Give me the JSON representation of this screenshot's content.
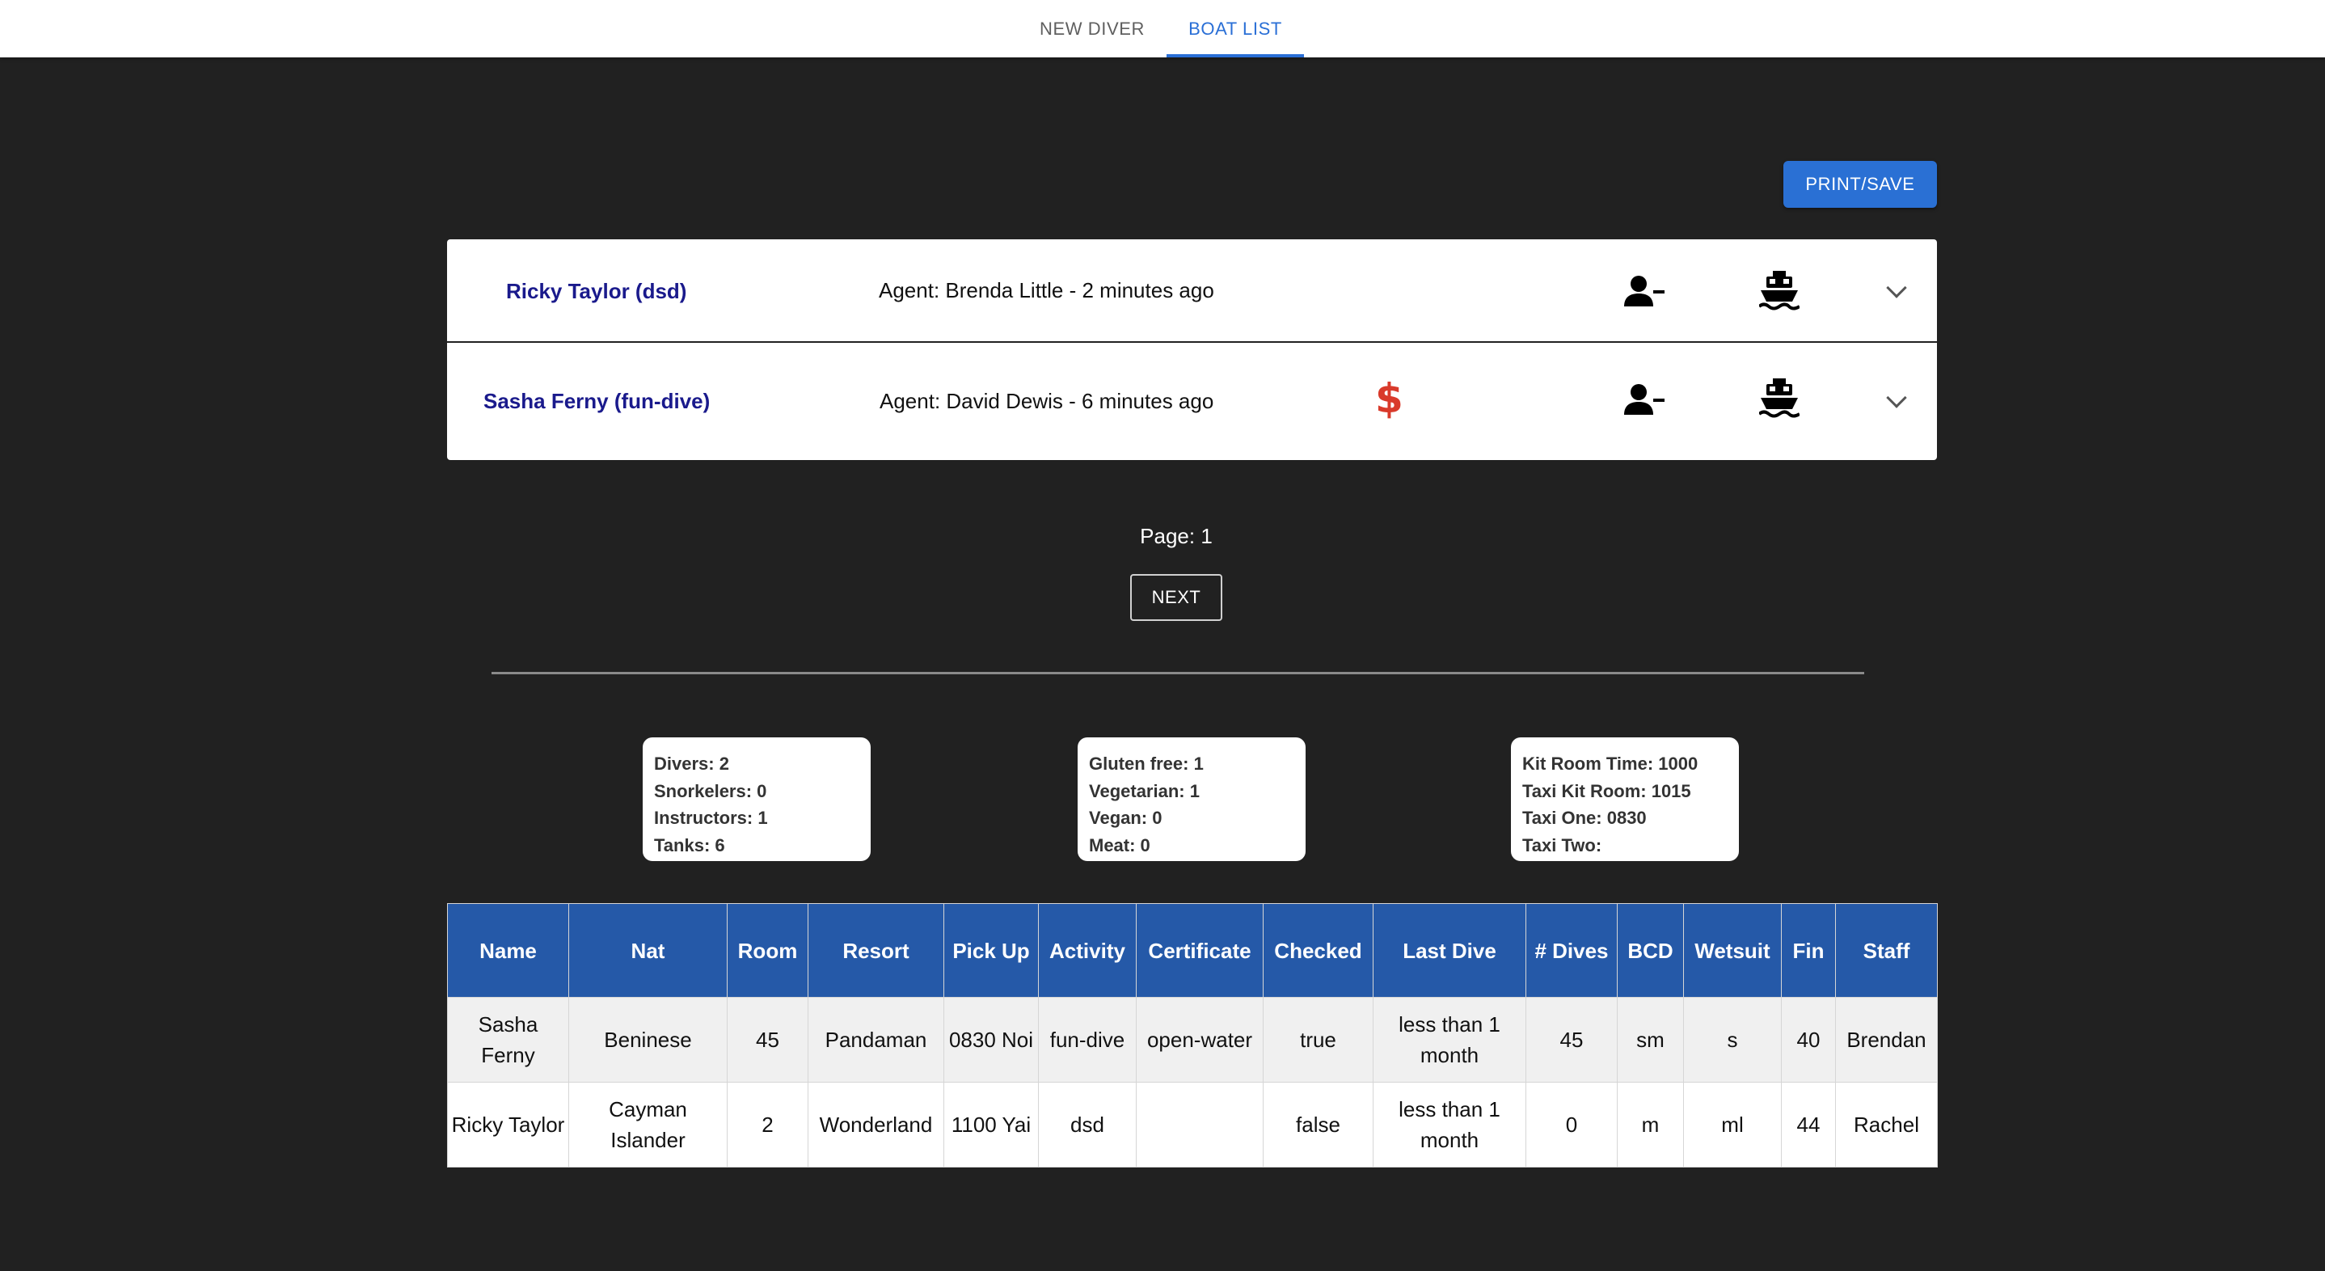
{
  "nav": {
    "tabs": [
      {
        "label": "NEW DIVER",
        "active": false
      },
      {
        "label": "BOAT LIST",
        "active": true
      }
    ]
  },
  "toolbar": {
    "print_label": "PRINT/SAVE"
  },
  "divers": [
    {
      "name": "Ricky Taylor (dsd)",
      "agent": "Agent: Brenda Little - 2 minutes ago",
      "unpaid": false
    },
    {
      "name": "Sasha Ferny (fun-dive)",
      "agent": "Agent: David Dewis - 6 minutes ago",
      "unpaid": true,
      "unpaid_symbol": "$"
    }
  ],
  "icons": {
    "remove_person": "person-remove-icon",
    "boat": "boat-icon",
    "expand": "chevron-down-icon",
    "unpaid": "dollar-icon"
  },
  "pagination": {
    "page_label": "Page: 1",
    "next_label": "NEXT"
  },
  "summary": {
    "counts": [
      "Divers: 2",
      "Snorkelers: 0",
      "Instructors: 1",
      "Tanks: 6"
    ],
    "diet": [
      "Gluten free: 1",
      "Vegetarian: 1",
      "Vegan: 0",
      "Meat: 0"
    ],
    "times": [
      "Kit Room Time: 1000",
      "Taxi Kit Room: 1015",
      "Taxi One: 0830",
      "Taxi Two:"
    ]
  },
  "table": {
    "headers": [
      "Name",
      "Nat",
      "Room",
      "Resort",
      "Pick Up",
      "Activity",
      "Certificate",
      "Checked",
      "Last Dive",
      "# Dives",
      "BCD",
      "Wetsuit",
      "Fin",
      "Staff"
    ],
    "rows": [
      [
        "Sasha Ferny",
        "Beninese",
        "45",
        "Pandaman",
        "0830 Noi",
        "fun-dive",
        "open-water",
        "true",
        "less than 1 month",
        "45",
        "sm",
        "s",
        "40",
        "Brendan"
      ],
      [
        "Ricky Taylor",
        "Cayman Islander",
        "2",
        "Wonderland",
        "1100 Yai",
        "dsd",
        "",
        "false",
        "less than 1 month",
        "0",
        "m",
        "ml",
        "44",
        "Rachel"
      ]
    ]
  },
  "colors": {
    "accent": "#2a6fd6",
    "header_bg": "#2559a8",
    "unpaid": "#d93a2b",
    "page_bg": "#212121"
  }
}
